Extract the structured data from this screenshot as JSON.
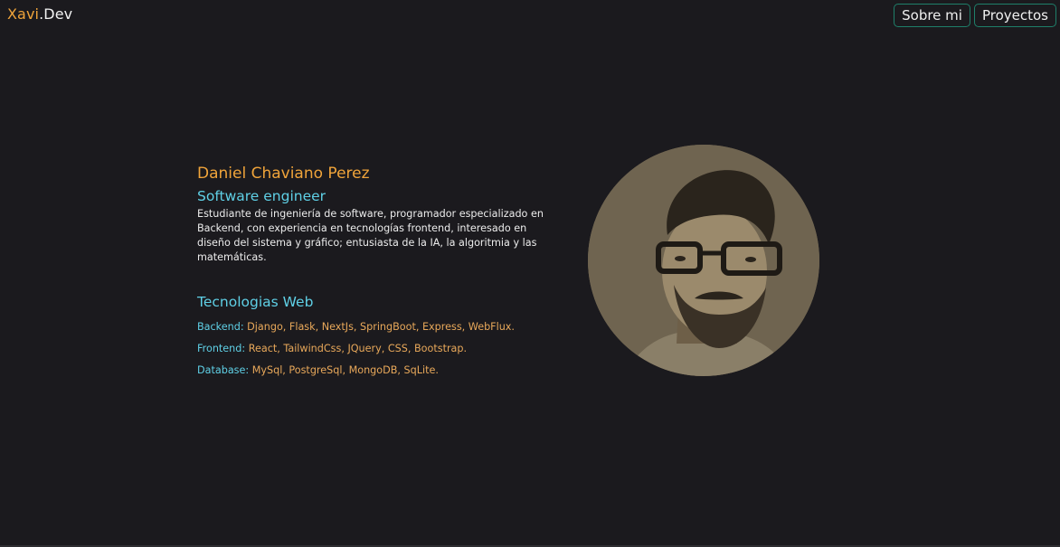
{
  "header": {
    "logo_primary": "Xavi",
    "logo_secondary": ".Dev",
    "nav": [
      {
        "label": "Sobre mi"
      },
      {
        "label": "Proyectos"
      }
    ]
  },
  "profile": {
    "name": "Daniel Chaviano Perez",
    "role": "Software engineer",
    "description": "Estudiante de ingeniería de software, programador especializado en Backend, con experiencia en tecnologías frontend, interesado en diseño del sistema y gráfico; entusiasta de la IA, la algoritmia y las matemáticas."
  },
  "technologies": {
    "title": "Tecnologias Web",
    "rows": [
      {
        "label": "Backend:",
        "value": "Django, Flask, NextJs, SpringBoot, Express, WebFlux."
      },
      {
        "label": "Frontend:",
        "value": "React, TailwindCss, JQuery, CSS, Bootstrap."
      },
      {
        "label": "Database:",
        "value": "MySql, PostgreSql, MongoDB, SqLite."
      }
    ]
  },
  "colors": {
    "background": "#1b1a1e",
    "accent_orange": "#f0a43a",
    "accent_cyan": "#5fd0e6",
    "nav_border": "#1f7f6a"
  }
}
